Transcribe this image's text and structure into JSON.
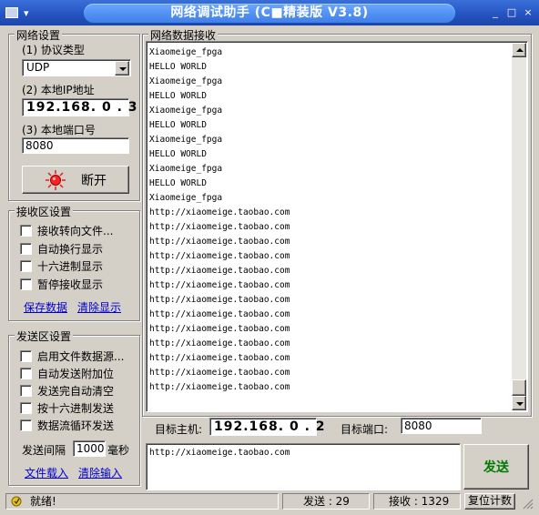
{
  "window": {
    "title": "网络调试助手 (C■精装版 V3.8)",
    "menu_indicator": "▾",
    "controls": [
      "_",
      "□",
      "×"
    ]
  },
  "network": {
    "title": "网络设置",
    "protocol_label": "(1) 协议类型",
    "protocol_value": "UDP",
    "local_ip_label": "(2) 本地IP地址",
    "local_ip_value": "192.168. 0 . 3",
    "local_port_label": "(3) 本地端口号",
    "local_port_value": "8080",
    "disconnect_label": "断开"
  },
  "receive_settings": {
    "title": "接收区设置",
    "options": [
      {
        "label": "接收转向文件...",
        "checked": false
      },
      {
        "label": "自动换行显示",
        "checked": false
      },
      {
        "label": "十六进制显示",
        "checked": false
      },
      {
        "label": "暂停接收显示",
        "checked": false
      }
    ],
    "save_label": "保存数据",
    "clear_label": "清除显示"
  },
  "send_settings": {
    "title": "发送区设置",
    "options": [
      {
        "label": "启用文件数据源...",
        "checked": false
      },
      {
        "label": "自动发送附加位",
        "checked": false
      },
      {
        "label": "发送完自动清空",
        "checked": false
      },
      {
        "label": "按十六进制发送",
        "checked": false
      },
      {
        "label": "数据流循环发送",
        "checked": false
      }
    ],
    "interval_label": "发送间隔",
    "interval_value": "1000",
    "interval_unit": "毫秒",
    "load_file_label": "文件载入",
    "clear_input_label": "清除输入"
  },
  "receive": {
    "title": "网络数据接收",
    "lines": [
      "Xiaomeige_fpga",
      "HELLO WORLD",
      "Xiaomeige_fpga",
      "HELLO WORLD",
      "Xiaomeige_fpga",
      "HELLO WORLD",
      "Xiaomeige_fpga",
      "HELLO WORLD",
      "Xiaomeige_fpga",
      "HELLO WORLD",
      "Xiaomeige_fpga",
      "http://xiaomeige.taobao.com",
      "http://xiaomeige.taobao.com",
      "http://xiaomeige.taobao.com",
      "http://xiaomeige.taobao.com",
      "http://xiaomeige.taobao.com",
      "http://xiaomeige.taobao.com",
      "http://xiaomeige.taobao.com",
      "http://xiaomeige.taobao.com",
      "http://xiaomeige.taobao.com",
      "http://xiaomeige.taobao.com",
      "http://xiaomeige.taobao.com",
      "http://xiaomeige.taobao.com",
      "http://xiaomeige.taobao.com"
    ]
  },
  "target": {
    "host_label": "目标主机:",
    "host_value": "192.168. 0 . 2",
    "port_label": "目标端口:",
    "port_value": "8080"
  },
  "send": {
    "text": "http://xiaomeige.taobao.com",
    "button_label": "发送"
  },
  "status": {
    "ready_text": "就绪!",
    "sent_text": "发送 : 29",
    "received_text": "接收 : 1329",
    "reset_label": "复位计数"
  }
}
